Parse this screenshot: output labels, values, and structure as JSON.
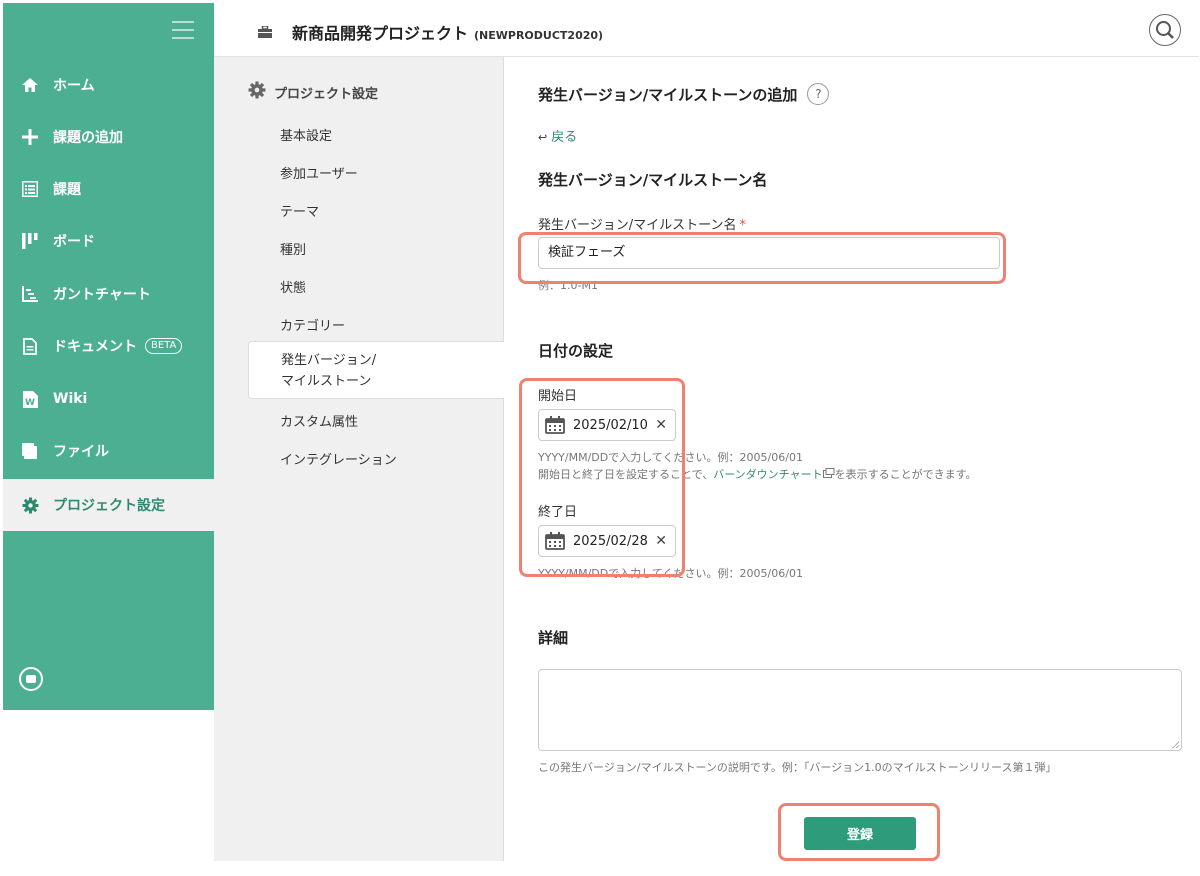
{
  "sidebar": {
    "items": [
      {
        "label": "ホーム",
        "icon": "home-icon"
      },
      {
        "label": "課題の追加",
        "icon": "plus-icon"
      },
      {
        "label": "課題",
        "icon": "list-icon"
      },
      {
        "label": "ボード",
        "icon": "board-icon"
      },
      {
        "label": "ガントチャート",
        "icon": "gantt-icon"
      },
      {
        "label": "ドキュメント",
        "icon": "document-icon",
        "badge": "BETA"
      },
      {
        "label": "Wiki",
        "icon": "wiki-icon"
      },
      {
        "label": "ファイル",
        "icon": "folder-icon"
      },
      {
        "label": "プロジェクト設定",
        "icon": "gear-icon",
        "active": true
      }
    ],
    "accent": "#4caf92"
  },
  "header": {
    "project_name": "新商品開発プロジェクト",
    "project_key": "(NEWPRODUCT2020)"
  },
  "submenu": {
    "title": "プロジェクト設定",
    "items": [
      "基本設定",
      "参加ユーザー",
      "テーマ",
      "種別",
      "状態",
      "カテゴリー"
    ],
    "active_line1": "発生バージョン/",
    "active_line2": "マイルストーン",
    "items_after": [
      "カスタム属性",
      "インテグレーション"
    ]
  },
  "form": {
    "page_title": "発生バージョン/マイルストーンの追加",
    "help": "?",
    "back": "戻る",
    "name_section": "発生バージョン/マイルストーン名",
    "name_label": "発生バージョン/マイルストーン名",
    "required_mark": "*",
    "name_value": "検証フェーズ",
    "name_hint": "例：1.0-M1",
    "date_section": "日付の設定",
    "start_label": "開始日",
    "start_value": "2025/02/10",
    "start_hint": "YYYY/MM/DDで入力してください。例：2005/06/01",
    "burndown_pre": "開始日と終了日を設定することで、",
    "burndown_link": "バーンダウンチャート",
    "burndown_post": "を表示することができます。",
    "end_label": "終了日",
    "end_value": "2025/02/28",
    "end_hint": "YYYY/MM/DDで入力してください。例：2005/06/01",
    "detail_section": "詳細",
    "detail_hint": "この発生バージョン/マイルストーンの説明です。例：「バージョン1.0のマイルストーンリリース第１弾」",
    "clear": "✕",
    "submit": "登録",
    "submit_color": "#2e9c7a",
    "highlight_color": "#f08070"
  }
}
